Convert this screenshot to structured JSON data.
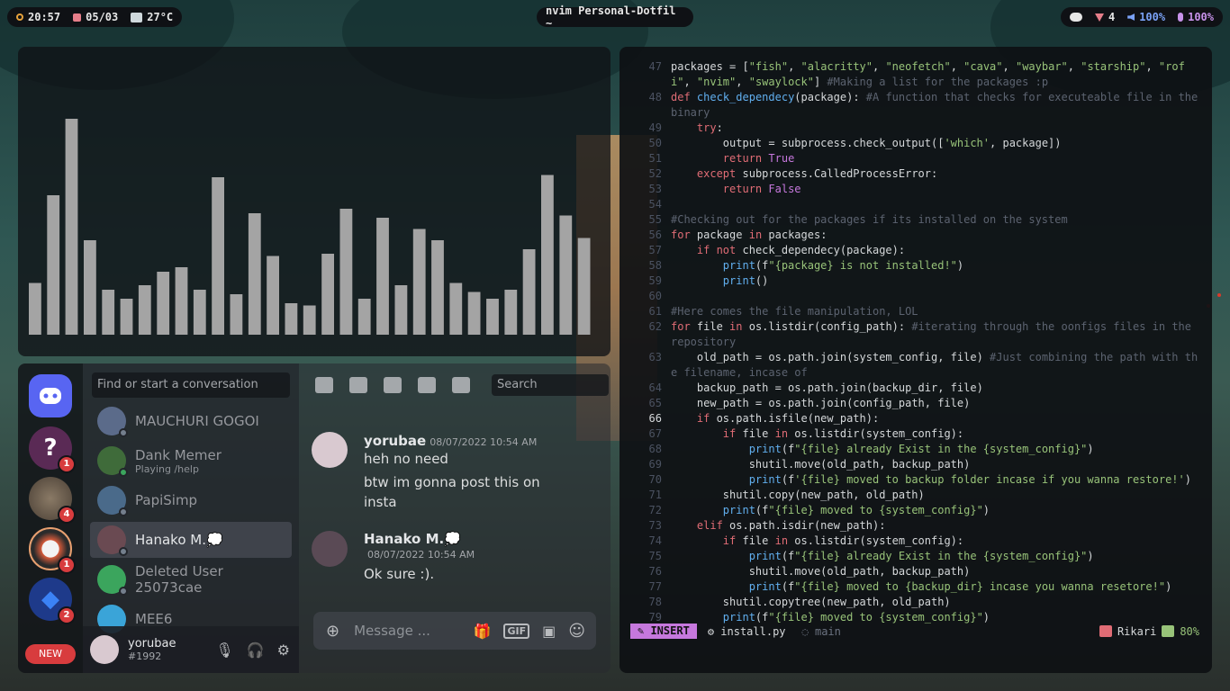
{
  "topbar": {
    "time": "20:57",
    "date": "05/03",
    "temperature": "27°C",
    "window_title": "nvim Personal-Dotfil ~",
    "downloads": "4",
    "volume": "100%",
    "mic": "100%"
  },
  "visualizer": {
    "levels": [
      0.23,
      0.62,
      0.96,
      0.42,
      0.2,
      0.16,
      0.22,
      0.28,
      0.3,
      0.2,
      0.7,
      0.18,
      0.54,
      0.35,
      0.14,
      0.13,
      0.36,
      0.56,
      0.16,
      0.52,
      0.22,
      0.47,
      0.42,
      0.23,
      0.19,
      0.16,
      0.2,
      0.38,
      0.71,
      0.53,
      0.43
    ]
  },
  "editor": {
    "lines": [
      {
        "num": "47",
        "html": "packages = [<span class='st'>\"fish\"</span>, <span class='st'>\"alacritty\"</span>, <span class='st'>\"neofetch\"</span>, <span class='st'>\"cava\"</span>, <span class='st'>\"waybar\"</span>, <span class='st'>\"starship\"</span>, <span class='st'>\"rofi\"</span>, <span class='st'>\"nvim\"</span>, <span class='st'>\"swaylock\"</span>] <span class='cm'>#Making a list for the packages :p</span>"
      },
      {
        "num": "48",
        "html": "<span class='kw'>def</span> <span class='fn'>check_dependecy</span>(package): <span class='cm'>#A function that checks for executeable file in the binary</span>"
      },
      {
        "num": "49",
        "html": "    <span class='kw'>try</span>:"
      },
      {
        "num": "50",
        "html": "        output = subprocess.check_output([<span class='st'>'which'</span>, package])"
      },
      {
        "num": "51",
        "html": "        <span class='kw'>return</span> <span class='bi'>True</span>"
      },
      {
        "num": "52",
        "html": "    <span class='kw'>except</span> subprocess.CalledProcessError:"
      },
      {
        "num": "53",
        "html": "        <span class='kw'>return</span> <span class='bi'>False</span>"
      },
      {
        "num": "54",
        "html": ""
      },
      {
        "num": "55",
        "html": "<span class='cm'>#Checking out for the packages if its installed on the system</span>"
      },
      {
        "num": "56",
        "html": "<span class='kw'>for</span> package <span class='kw'>in</span> packages:"
      },
      {
        "num": "57",
        "html": "    <span class='kw'>if not</span> check_dependecy(package):"
      },
      {
        "num": "58",
        "html": "        <span class='fn'>print</span>(f<span class='st'>\"{package} is not installed!\"</span>)"
      },
      {
        "num": "59",
        "html": "        <span class='fn'>print</span>()"
      },
      {
        "num": "60",
        "html": ""
      },
      {
        "num": "61",
        "html": "<span class='cm'>#Here comes the file manipulation, LOL</span>"
      },
      {
        "num": "62",
        "html": "<span class='kw'>for</span> file <span class='kw'>in</span> os.listdir(config_path): <span class='cm'>#iterating through the oonfigs files in the repository</span>"
      },
      {
        "num": "63",
        "html": "    old_path = os.path.join(system_config, file) <span class='cm'>#Just combining the path with the filename, incase of</span>"
      },
      {
        "num": "64",
        "html": "    backup_path = os.path.join(backup_dir, file)"
      },
      {
        "num": "65",
        "html": "    new_path = os.path.join(config_path, file)"
      },
      {
        "num": "66",
        "html": "    <span class='kw'>if</span> os.path.isfile(new_path):",
        "current": true
      },
      {
        "num": "67",
        "html": "        <span class='kw'>if</span> file <span class='kw'>in</span> os.listdir(system_config):"
      },
      {
        "num": "68",
        "html": "            <span class='fn'>print</span>(f<span class='st'>\"{file} already Exist in the {system_config}\"</span>)"
      },
      {
        "num": "69",
        "html": "            shutil.move(old_path, backup_path)"
      },
      {
        "num": "70",
        "html": "            <span class='fn'>print</span>(f<span class='st'>'{file} moved to backup folder incase if you wanna restore!'</span>)"
      },
      {
        "num": "71",
        "html": "        shutil.copy(new_path, old_path)"
      },
      {
        "num": "72",
        "html": "        <span class='fn'>print</span>(f<span class='st'>\"{file} moved to {system_config}\"</span>)"
      },
      {
        "num": "73",
        "html": "    <span class='kw'>elif</span> os.path.isdir(new_path):"
      },
      {
        "num": "74",
        "html": "        <span class='kw'>if</span> file <span class='kw'>in</span> os.listdir(system_config):"
      },
      {
        "num": "75",
        "html": "            <span class='fn'>print</span>(f<span class='st'>\"{file} already Exist in the {system_config}\"</span>)"
      },
      {
        "num": "76",
        "html": "            shutil.move(old_path, backup_path)"
      },
      {
        "num": "77",
        "html": "            <span class='fn'>print</span>(f<span class='st'>\"{file} moved to {backup_dir} incase you wanna resetore!\"</span>)"
      },
      {
        "num": "78",
        "html": "        shutil.copytree(new_path, old_path)"
      },
      {
        "num": "79",
        "html": "        <span class='fn'>print</span>(f<span class='st'>\"{file} moved to {system_config}\"</span>)"
      }
    ],
    "status": {
      "mode": "INSERT",
      "file": "install.py",
      "branch": "main",
      "user": "Rikari",
      "percent": "80%"
    }
  },
  "discord": {
    "dm_search_placeholder": "Find or start a conversation",
    "servers": [
      {
        "name": "home",
        "badge": ""
      },
      {
        "name": "server-1",
        "badge": "1"
      },
      {
        "name": "server-2",
        "badge": "4"
      },
      {
        "name": "server-3",
        "badge": "1"
      },
      {
        "name": "server-4",
        "badge": "2"
      }
    ],
    "new_label": "NEW",
    "dms": [
      {
        "name": "MAUCHURI GOGOI",
        "sub": ""
      },
      {
        "name": "Dank Memer",
        "sub": "Playing /help"
      },
      {
        "name": "PapiSimp",
        "sub": ""
      },
      {
        "name": "Hanako M.💭",
        "sub": ""
      },
      {
        "name": "Deleted User 25073cae",
        "sub": ""
      },
      {
        "name": "MEE6",
        "sub": ""
      }
    ],
    "user": {
      "name": "yorubae",
      "tag": "#1992"
    },
    "chat_search_placeholder": "Search",
    "messages": [
      {
        "author": "yorubae",
        "time": "08/07/2022 10:54 AM",
        "lines": [
          "heh no need",
          "btw im gonna post this on insta"
        ]
      },
      {
        "author": "Hanako M.💭",
        "time": "08/07/2022 10:54 AM",
        "lines": [
          "Ok sure :)."
        ]
      }
    ],
    "composer_placeholder": "Message ...",
    "gif_label": "GIF"
  }
}
